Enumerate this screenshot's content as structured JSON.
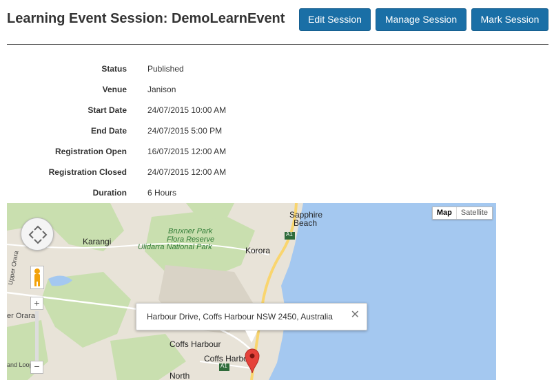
{
  "header": {
    "title": "Learning Event Session: DemoLearnEvent",
    "buttons": {
      "edit": "Edit Session",
      "manage": "Manage Session",
      "mark": "Mark Session"
    }
  },
  "details": [
    {
      "label": "Status",
      "value": "Published"
    },
    {
      "label": "Venue",
      "value": "Janison"
    },
    {
      "label": "Start Date",
      "value": "24/07/2015 10:00 AM"
    },
    {
      "label": "End Date",
      "value": "24/07/2015 5:00 PM"
    },
    {
      "label": "Registration Open",
      "value": "16/07/2015 12:00 AM"
    },
    {
      "label": "Registration Closed",
      "value": "24/07/2015 12:00 AM"
    },
    {
      "label": "Duration",
      "value": "6 Hours"
    }
  ],
  "map": {
    "type_map": "Map",
    "type_satellite": "Satellite",
    "zoom_in": "+",
    "zoom_out": "−",
    "info_address": "Harbour Drive, Coffs Harbour NSW 2450, Australia",
    "info_close": "✕",
    "labels": {
      "sapphire": "Sapphire",
      "beach": "Beach",
      "bruxner": "Bruxner Park",
      "flora": "Flora Reserve",
      "ulidarra": "Ulidarra National Park",
      "karangi": "Karangi",
      "korora": "Korora",
      "a1_top": "A1",
      "a1_bottom": "A1",
      "coffs1": "Coffs Harbour",
      "coffs2": "Coffs Harbour",
      "north": "North",
      "upper_orara": "Upper Orara",
      "orara": "er Orara",
      "loop": "and Loop"
    },
    "colors": {
      "sea": "#a4c8f0",
      "land": "#e8e3d8",
      "park": "#c9dfaf",
      "highway": "#f9d56e",
      "marker": "#e5423a"
    }
  }
}
